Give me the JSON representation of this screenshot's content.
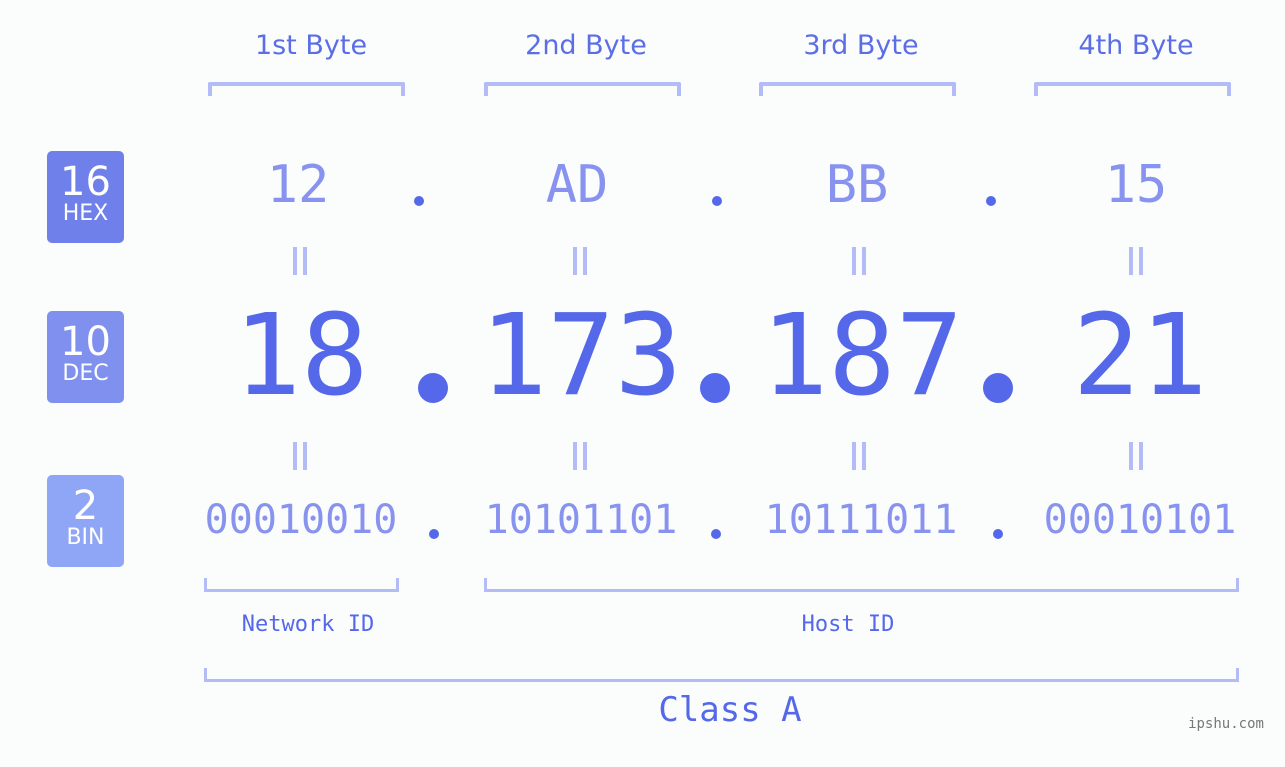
{
  "bytes": {
    "labels": [
      "1st Byte",
      "2nd Byte",
      "3rd Byte",
      "4th Byte"
    ]
  },
  "badges": {
    "hex": {
      "number": "16",
      "label": "HEX",
      "color": "#7080ea"
    },
    "dec": {
      "number": "10",
      "label": "DEC",
      "color": "#8090ee"
    },
    "bin": {
      "number": "2",
      "label": "BIN",
      "color": "#8fa5f5"
    }
  },
  "ip": {
    "hex": [
      "12",
      "AD",
      "BB",
      "15"
    ],
    "dec": [
      "18",
      "173",
      "187",
      "21"
    ],
    "bin": [
      "00010010",
      "10101101",
      "10111011",
      "00010101"
    ],
    "separator": "."
  },
  "segments": {
    "network_id": "Network ID",
    "host_id": "Host ID"
  },
  "ip_class": "Class A",
  "colors": {
    "primary": "#5568ea",
    "secondary": "#8893ef",
    "bracket": "#b3bcf6",
    "background": "#fbfdfc"
  },
  "watermark": "ipshu.com"
}
